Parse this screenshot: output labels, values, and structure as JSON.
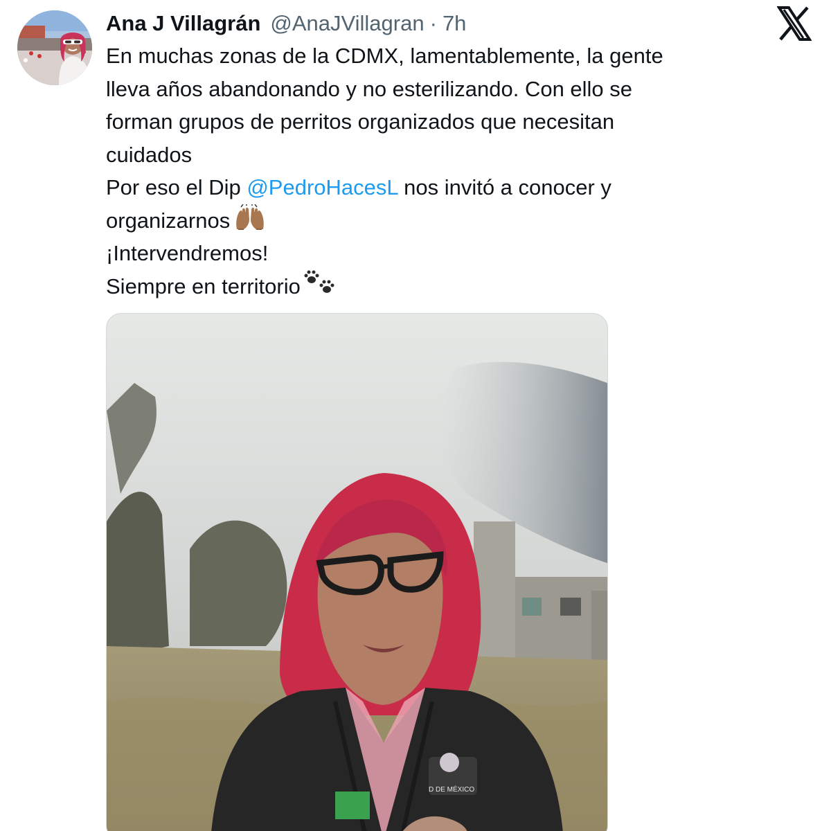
{
  "post": {
    "author": {
      "display_name": "Ana J Villagrán",
      "handle": "@AnaJVillagran",
      "separator": "·",
      "timestamp": "7h"
    },
    "platform_icon": "x-logo-icon",
    "text_lines": [
      "En muchas zonas de la CDMX, lamentablemente, la gente",
      "lleva años abandonando y no esterilizando. Con ello se",
      "forman grupos de perritos organizados que necesitan",
      "cuidados"
    ],
    "line5_prefix": "Por eso el Dip ",
    "mention": "@PedroHacesL",
    "line5_suffix": " nos invitó a conocer y",
    "line6_text": "organizarnos",
    "line6_emoji": "raising-hands-icon",
    "line7_text": "¡Intervendremos!",
    "line8_text": "Siempre en territorio",
    "line8_emoji": "paw-prints-icon",
    "media": {
      "kind": "video-thumbnail",
      "badge_text": "D DE MÉXICO"
    }
  },
  "colors": {
    "text_primary": "#0f1419",
    "text_secondary": "#536471",
    "link": "#1d9bf0",
    "media_border": "#cfd9de"
  }
}
